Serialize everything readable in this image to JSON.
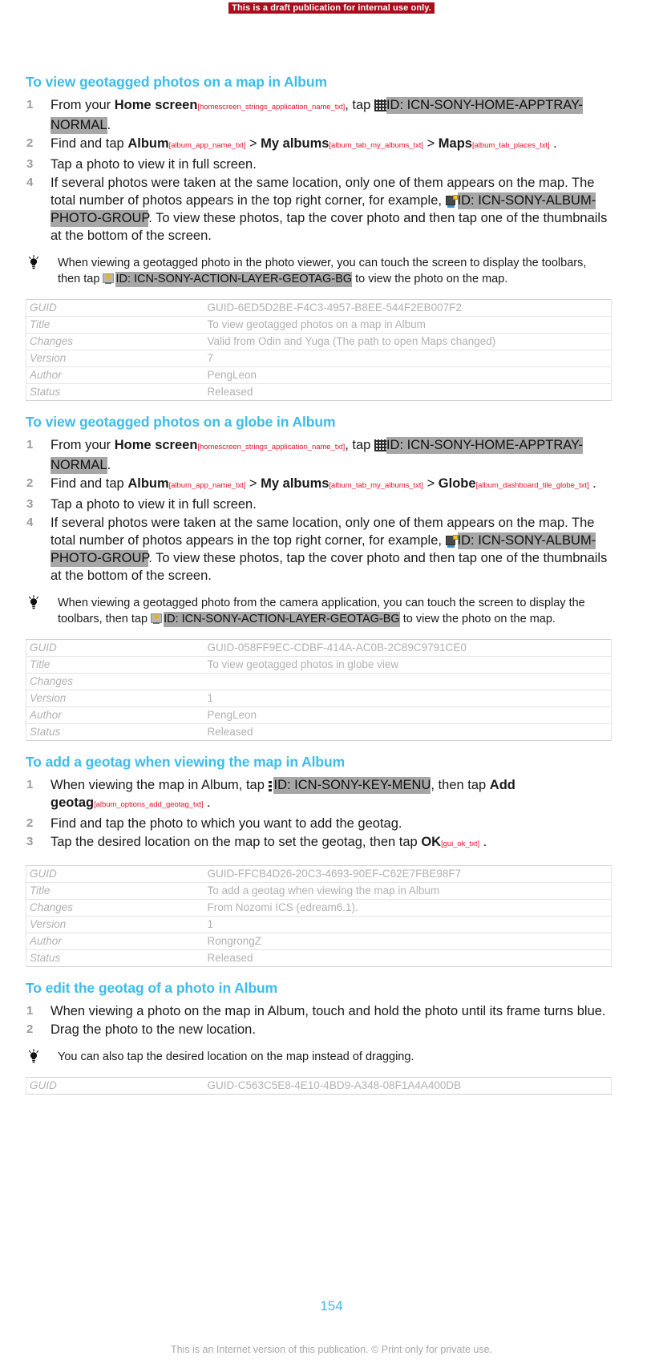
{
  "banner": {
    "text": "This is a draft publication for internal use only."
  },
  "icons": {
    "apptray": "apptray-grid-icon",
    "photogroup": "album-photo-group-icon",
    "geotag": "action-layer-geotag-icon",
    "keymenu": "key-menu-icon",
    "tip": "tip-lightbulb-icon"
  },
  "sections": [
    {
      "title": "To view geotagged photos on a map in Album",
      "steps": [
        {
          "num": "1",
          "parts": [
            {
              "t": "text",
              "v": "From your "
            },
            {
              "t": "bold",
              "v": "Home screen"
            },
            {
              "t": "sid",
              "v": "[homescreen_strings_application_name_txt]"
            },
            {
              "t": "text",
              "v": ", tap "
            },
            {
              "t": "icon",
              "v": "apptray"
            },
            {
              "t": "idtag",
              "v": "ID: ICN-SONY-HOME-APPTRAY-NORMAL"
            },
            {
              "t": "text",
              "v": "."
            }
          ]
        },
        {
          "num": "2",
          "parts": [
            {
              "t": "text",
              "v": "Find and tap "
            },
            {
              "t": "bold",
              "v": "Album"
            },
            {
              "t": "sid",
              "v": "[album_app_name_txt]"
            },
            {
              "t": "text",
              "v": " > "
            },
            {
              "t": "bold",
              "v": "My albums"
            },
            {
              "t": "sid",
              "v": "[album_tab_my_albums_txt]"
            },
            {
              "t": "text",
              "v": " > "
            },
            {
              "t": "bold",
              "v": "Maps"
            },
            {
              "t": "sid",
              "v": "[album_tab_places_txt]"
            },
            {
              "t": "text",
              "v": " ."
            }
          ]
        },
        {
          "num": "3",
          "parts": [
            {
              "t": "text",
              "v": "Tap a photo to view it in full screen."
            }
          ]
        },
        {
          "num": "4",
          "parts": [
            {
              "t": "text",
              "v": "If several photos were taken at the same location, only one of them appears on the map. The total number of photos appears in the top right corner, for example, "
            },
            {
              "t": "icon",
              "v": "photogroup"
            },
            {
              "t": "idtag",
              "v": "ID: ICN-SONY-ALBUM-PHOTO-GROUP"
            },
            {
              "t": "text",
              "v": ". To view these photos, tap the cover photo and then tap one of the thumbnails at the bottom of the screen."
            }
          ]
        }
      ],
      "tip": [
        {
          "t": "text",
          "v": "When viewing a geotagged photo in the photo viewer, you can touch the screen to display the toolbars, then tap "
        },
        {
          "t": "icon",
          "v": "geotag"
        },
        {
          "t": "idtag",
          "v": "ID: ICN-SONY-ACTION-LAYER-GEOTAG-BG"
        },
        {
          "t": "text",
          "v": " to view the photo on the map."
        }
      ],
      "meta": [
        {
          "key": "GUID",
          "value": "GUID-6ED5D2BE-F4C3-4957-B8EE-544F2EB007F2"
        },
        {
          "key": "Title",
          "value": "To view geotagged photos on a map in Album"
        },
        {
          "key": "Changes",
          "value": "Valid from Odin and Yuga (The path to open Maps changed)"
        },
        {
          "key": "Version",
          "value": "7"
        },
        {
          "key": "Author",
          "value": "PengLeon"
        },
        {
          "key": "Status",
          "value": "Released"
        }
      ]
    },
    {
      "title": "To view geotagged photos on a globe in Album",
      "steps": [
        {
          "num": "1",
          "parts": [
            {
              "t": "text",
              "v": "From your "
            },
            {
              "t": "bold",
              "v": "Home screen"
            },
            {
              "t": "sid",
              "v": "[homescreen_strings_application_name_txt]"
            },
            {
              "t": "text",
              "v": ", tap "
            },
            {
              "t": "icon",
              "v": "apptray"
            },
            {
              "t": "idtag",
              "v": "ID: ICN-SONY-HOME-APPTRAY-NORMAL"
            },
            {
              "t": "text",
              "v": "."
            }
          ]
        },
        {
          "num": "2",
          "parts": [
            {
              "t": "text",
              "v": "Find and tap "
            },
            {
              "t": "bold",
              "v": "Album"
            },
            {
              "t": "sid",
              "v": "[album_app_name_txt]"
            },
            {
              "t": "text",
              "v": " > "
            },
            {
              "t": "bold",
              "v": "My albums"
            },
            {
              "t": "sid",
              "v": "[album_tab_my_albums_txt]"
            },
            {
              "t": "text",
              "v": " > "
            },
            {
              "t": "bold",
              "v": "Globe"
            },
            {
              "t": "sid",
              "v": "[album_dashboard_tile_globe_txt]"
            },
            {
              "t": "text",
              "v": " ."
            }
          ]
        },
        {
          "num": "3",
          "parts": [
            {
              "t": "text",
              "v": "Tap a photo to view it in full screen."
            }
          ]
        },
        {
          "num": "4",
          "parts": [
            {
              "t": "text",
              "v": "If several photos were taken at the same location, only one of them appears on the map. The total number of photos appears in the top right corner, for example, "
            },
            {
              "t": "icon",
              "v": "photogroup"
            },
            {
              "t": "idtag",
              "v": "ID: ICN-SONY-ALBUM-PHOTO-GROUP"
            },
            {
              "t": "text",
              "v": ". To view these photos, tap the cover photo and then tap one of the thumbnails at the bottom of the screen."
            }
          ]
        }
      ],
      "tip": [
        {
          "t": "text",
          "v": "When viewing a geotagged photo from the camera application, you can touch the screen to display the toolbars, then tap "
        },
        {
          "t": "icon",
          "v": "geotag"
        },
        {
          "t": "idtag",
          "v": "ID: ICN-SONY-ACTION-LAYER-GEOTAG-BG"
        },
        {
          "t": "text",
          "v": " to view the photo on the map."
        }
      ],
      "meta": [
        {
          "key": "GUID",
          "value": "GUID-058FF9EC-CDBF-414A-AC0B-2C89C9791CE0"
        },
        {
          "key": "Title",
          "value": "To view geotagged photos in globe view"
        },
        {
          "key": "Changes",
          "value": ""
        },
        {
          "key": "Version",
          "value": "1"
        },
        {
          "key": "Author",
          "value": "PengLeon"
        },
        {
          "key": "Status",
          "value": "Released"
        }
      ]
    },
    {
      "title": "To add a geotag when viewing the map in Album",
      "steps": [
        {
          "num": "1",
          "parts": [
            {
              "t": "text",
              "v": "When viewing the map in Album, tap "
            },
            {
              "t": "icon",
              "v": "keymenu"
            },
            {
              "t": "idtag",
              "v": "ID: ICN-SONY-KEY-MENU"
            },
            {
              "t": "text",
              "v": ", then tap "
            },
            {
              "t": "bold",
              "v": "Add geotag"
            },
            {
              "t": "sid",
              "v": "[album_options_add_geotag_txt]"
            },
            {
              "t": "text",
              "v": " ."
            }
          ]
        },
        {
          "num": "2",
          "parts": [
            {
              "t": "text",
              "v": "Find and tap the photo to which you want to add the geotag."
            }
          ]
        },
        {
          "num": "3",
          "parts": [
            {
              "t": "text",
              "v": "Tap the desired location on the map to set the geotag, then tap "
            },
            {
              "t": "bold",
              "v": "OK"
            },
            {
              "t": "sid",
              "v": "[gui_ok_txt]"
            },
            {
              "t": "text",
              "v": " ."
            }
          ]
        }
      ],
      "tip": null,
      "meta": [
        {
          "key": "GUID",
          "value": "GUID-FFCB4D26-20C3-4693-90EF-C62E7FBE98F7"
        },
        {
          "key": "Title",
          "value": "To add a geotag when viewing the map in Album"
        },
        {
          "key": "Changes",
          "value": "From Nozomi ICS (edream6.1)."
        },
        {
          "key": "Version",
          "value": "1"
        },
        {
          "key": "Author",
          "value": "RongrongZ"
        },
        {
          "key": "Status",
          "value": "Released"
        }
      ]
    },
    {
      "title": "To edit the geotag of a photo in Album",
      "steps": [
        {
          "num": "1",
          "parts": [
            {
              "t": "text",
              "v": "When viewing a photo on the map in Album, touch and hold the photo until its frame turns blue."
            }
          ]
        },
        {
          "num": "2",
          "parts": [
            {
              "t": "text",
              "v": "Drag the photo to the new location."
            }
          ]
        }
      ],
      "tip": [
        {
          "t": "text",
          "v": "You can also tap the desired location on the map instead of dragging."
        }
      ],
      "meta": [
        {
          "key": "GUID",
          "value": "GUID-C563C5E8-4E10-4BD9-A348-08F1A4A400DB"
        }
      ]
    }
  ],
  "footer": {
    "page_number": "154",
    "note": "This is an Internet version of this publication. © Print only for private use."
  },
  "colors": {
    "heading": "#3cbcea",
    "string_id": "#e8112d",
    "id_highlight": "#a6a6a6",
    "meta_text": "#b2b2b2",
    "banner_bg": "#a80e1d"
  }
}
